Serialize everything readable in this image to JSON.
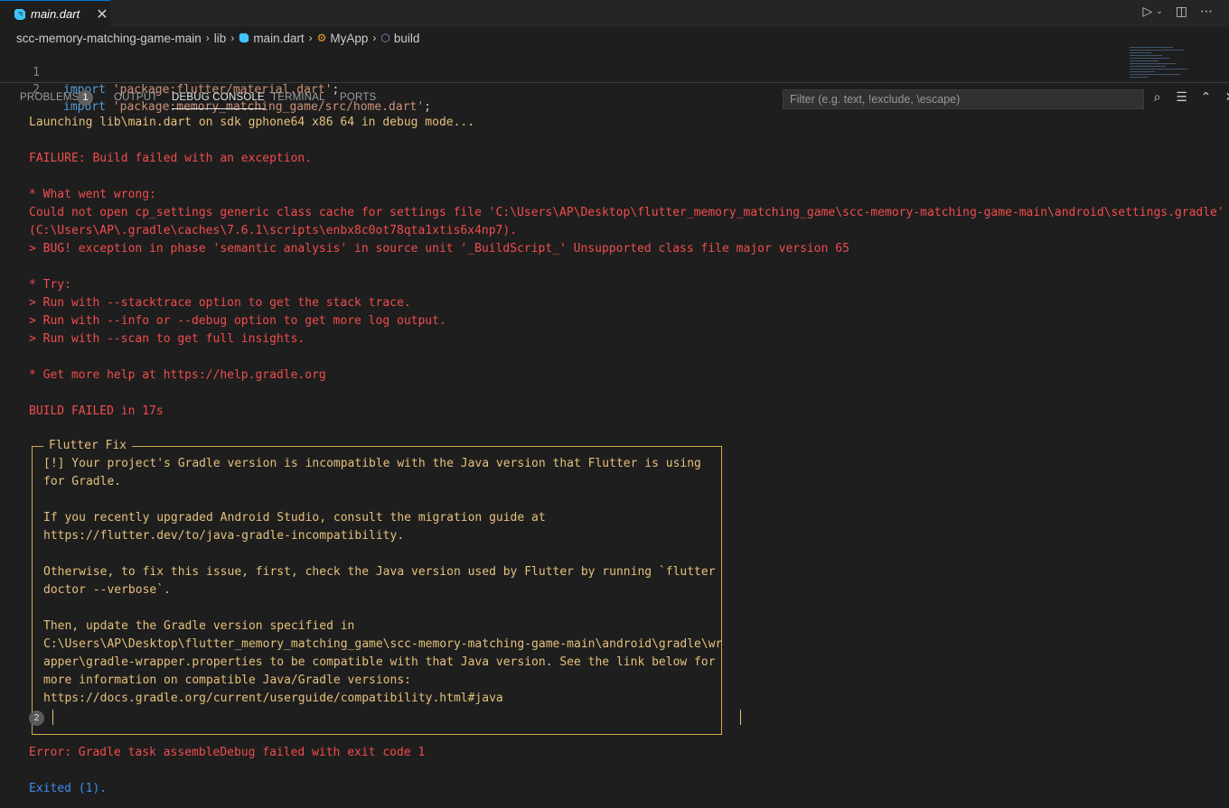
{
  "editor_tab": {
    "label": "main.dart",
    "icon": "dart-icon"
  },
  "breadcrumb": [
    "scc-memory-matching-game-main",
    "lib",
    "main.dart",
    "MyApp",
    "build"
  ],
  "code_lines": [
    {
      "num": "1",
      "kw": "import",
      "str": "'package:flutter/material.dart'",
      "end": ";"
    },
    {
      "num": "2",
      "kw": "import",
      "str": "'package:memory_matching_game/src/home.dart'",
      "end": ";"
    }
  ],
  "panel": {
    "tabs": [
      "PROBLEMS",
      "OUTPUT",
      "DEBUG CONSOLE",
      "TERMINAL",
      "PORTS"
    ],
    "problems_count": "1",
    "active_tab": "DEBUG CONSOLE",
    "filter_placeholder": "Filter (e.g. text, !exclude, \\escape)"
  },
  "console": {
    "launching": "Launching lib\\main.dart on sdk gphone64 x86 64 in debug mode...",
    "failure": "FAILURE: Build failed with an exception.",
    "what_wrong": "* What went wrong:",
    "err1": "Could not open cp_settings generic class cache for settings file 'C:\\Users\\AP\\Desktop\\flutter_memory_matching_game\\scc-memory-matching-game-main\\android\\settings.gradle'",
    "err2": "(C:\\Users\\AP\\.gradle\\caches\\7.6.1\\scripts\\enbx8c0ot78qta1xtis6x4np7).",
    "err3": "> BUG! exception in phase 'semantic analysis' in source unit '_BuildScript_' Unsupported class file major version 65",
    "try": "* Try:",
    "try1": "> Run with --stacktrace option to get the stack trace.",
    "try2": "> Run with --info or --debug option to get more log output.",
    "try3": "> Run with --scan to get full insights.",
    "help": "* Get more help at https://help.gradle.org",
    "build_failed": "BUILD FAILED in 17s",
    "fix_title": "Flutter Fix",
    "fix_lines": [
      "[!] Your project's Gradle version is incompatible with the Java version that Flutter is using",
      "for Gradle.",
      "",
      "If you recently upgraded Android Studio, consult the migration guide at",
      "https://flutter.dev/to/java-gradle-incompatibility.",
      "",
      "Otherwise, to fix this issue, first, check the Java version used by Flutter by running `flutter",
      "doctor --verbose`.",
      "",
      "Then, update the Gradle version specified in",
      "C:\\Users\\AP\\Desktop\\flutter_memory_matching_game\\scc-memory-matching-game-main\\android\\gradle\\wr",
      "apper\\gradle-wrapper.properties to be compatible with that Java version. See the link below for",
      "more information on compatible Java/Gradle versions:",
      "https://docs.gradle.org/current/userguide/compatibility.html#java"
    ],
    "repeat_count": "2",
    "gradle_error": "Error: Gradle task assembleDebug failed with exit code 1",
    "exited": "Exited (1)."
  },
  "colors": {
    "background": "#1e1e1e",
    "warning": "#e5c07b",
    "error": "#f14c4c",
    "info": "#3b8eea"
  }
}
